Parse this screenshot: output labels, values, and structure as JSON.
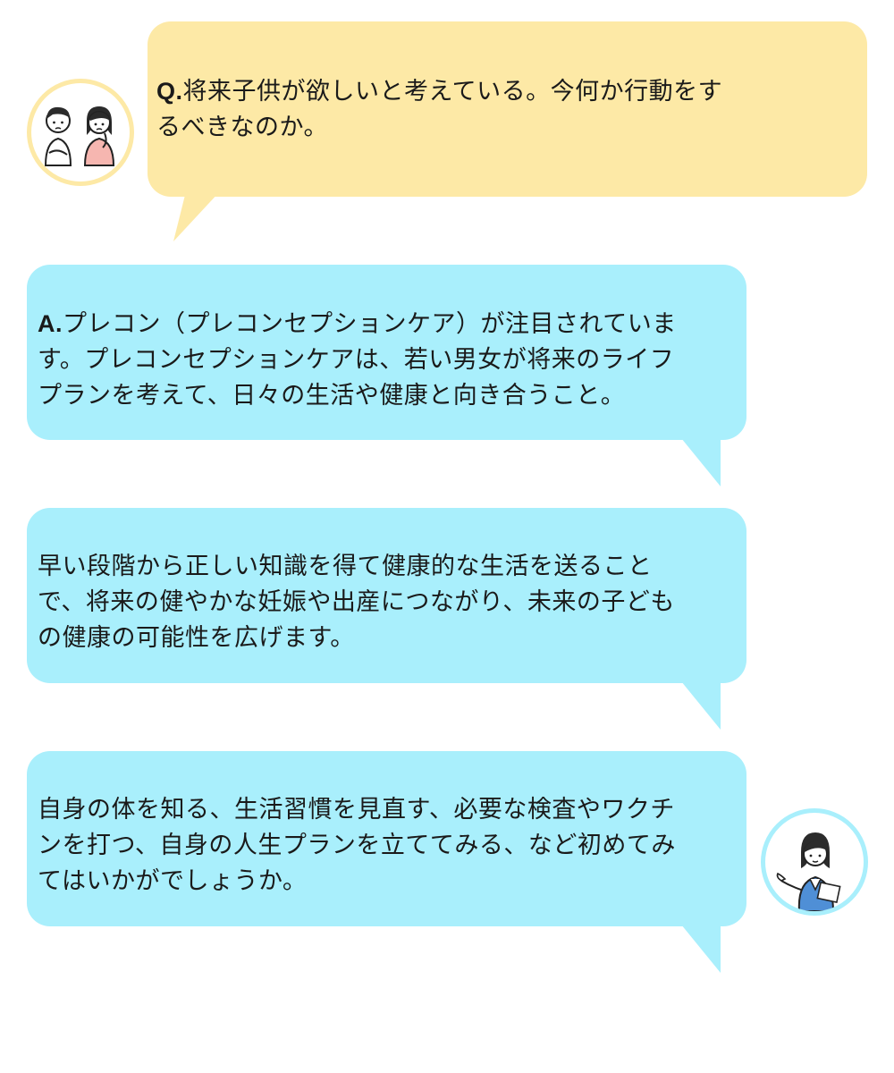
{
  "question": {
    "label": "Q.",
    "lines": [
      "将来子供が欲しいと考えている。今何か行動をす",
      "るべきなのか。"
    ],
    "bubble_color": "#fde9a6",
    "avatar_icon": "couple-thinking-icon"
  },
  "answers": [
    {
      "label": "A.",
      "lines": [
        "プレコン（プレコンセプションケア）が注目されていま",
        "す。プレコンセプションケアは、若い男女が将来のライフ",
        "プランを考えて、日々の生活や健康と向き合うこと。"
      ]
    },
    {
      "label": "",
      "lines": [
        "早い段階から正しい知識を得て健康的な生活を送ること",
        "で、将来の健やかな妊娠や出産につながり、未来の子ども",
        "の健康の可能性を広げます。"
      ]
    },
    {
      "label": "",
      "lines": [
        "自身の体を知る、生活習慣を見直す、必要な検査やワクチ",
        "ンを打つ、自身の人生プランを立ててみる、など初めてみ",
        "てはいかがでしょうか。"
      ]
    }
  ],
  "answer_bubble_color": "#a9effc",
  "advisor_avatar_icon": "advisor-woman-icon"
}
